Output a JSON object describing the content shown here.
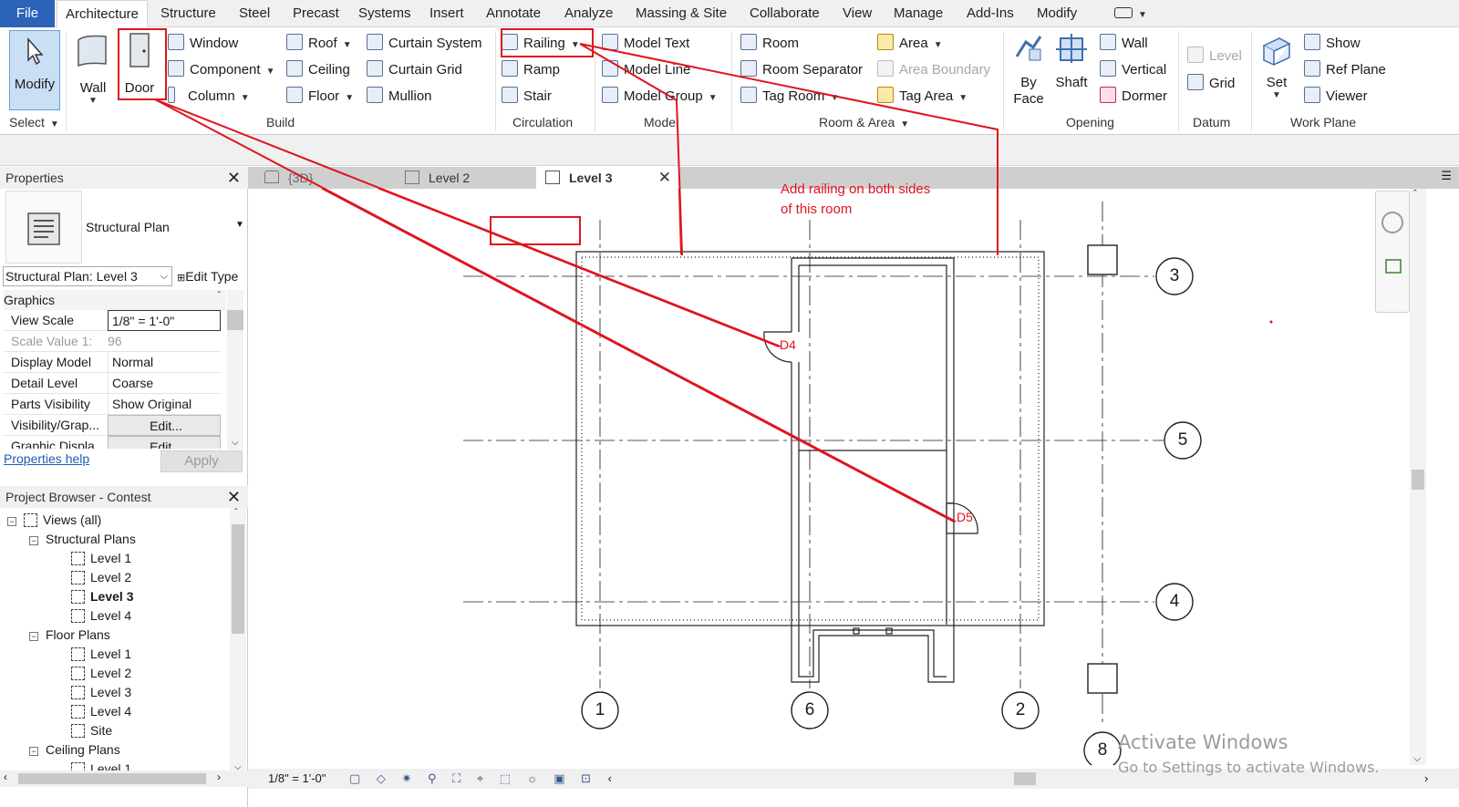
{
  "menubar": {
    "file": "File",
    "tabs": [
      "Architecture",
      "Structure",
      "Steel",
      "Precast",
      "Systems",
      "Insert",
      "Annotate",
      "Analyze",
      "Massing & Site",
      "Collaborate",
      "View",
      "Manage",
      "Add-Ins",
      "Modify"
    ]
  },
  "ribbon": {
    "modify": "Modify",
    "select_label": "Select",
    "wall": "Wall",
    "door": "Door",
    "window": "Window",
    "component": "Component",
    "column": "Column",
    "roof": "Roof",
    "ceiling": "Ceiling",
    "floor": "Floor",
    "curtain_system": "Curtain  System",
    "curtain_grid": "Curtain  Grid",
    "mullion": "Mullion",
    "build_label": "Build",
    "railing": "Railing",
    "ramp": "Ramp",
    "stair": "Stair",
    "circulation_label": "Circulation",
    "model_text": "Model  Text",
    "model_line": "Model  Line",
    "model_group": "Model  Group",
    "model_label": "Model",
    "room": "Room",
    "room_separator": "Room  Separator",
    "tag_room": "Tag  Room",
    "area": "Area",
    "area_boundary": "Area  Boundary",
    "tag_area": "Tag  Area",
    "room_area_label": "Room & Area",
    "by_face_1": "By",
    "by_face_2": "Face",
    "shaft": "Shaft",
    "wall_opening": "Wall",
    "vertical": "Vertical",
    "dormer": "Dormer",
    "opening_label": "Opening",
    "level": "Level",
    "grid": "Grid",
    "datum_label": "Datum",
    "set": "Set",
    "show": "Show",
    "ref_plane": "Ref  Plane",
    "viewer": "Viewer",
    "work_plane_label": "Work Plane"
  },
  "properties": {
    "title": "Properties",
    "type_name": "Structural Plan",
    "instance_select": "Structural Plan: Level 3",
    "edit_type": "Edit Type",
    "group": "Graphics",
    "rows": [
      {
        "k": "View Scale",
        "v": "1/8\" = 1'-0\""
      },
      {
        "k": "Scale Value    1:",
        "v": "96"
      },
      {
        "k": "Display Model",
        "v": "Normal"
      },
      {
        "k": "Detail Level",
        "v": "Coarse"
      },
      {
        "k": "Parts Visibility",
        "v": "Show Original"
      },
      {
        "k": "Visibility/Grap...",
        "v": "Edit..."
      },
      {
        "k": "Graphic Displa...",
        "v": "Edit..."
      }
    ],
    "help": "Properties help",
    "apply": "Apply"
  },
  "browser": {
    "title": "Project Browser - Contest",
    "views_all": "Views (all)",
    "structural_plans": "Structural Plans",
    "structural_items": [
      "Level 1",
      "Level 2",
      "Level 3",
      "Level 4"
    ],
    "floor_plans": "Floor Plans",
    "floor_items": [
      "Level 1",
      "Level 2",
      "Level 3",
      "Level 4",
      "Site"
    ],
    "ceiling_plans": "Ceiling Plans",
    "ceiling_items": [
      "Level 1"
    ]
  },
  "view_tabs": {
    "t1": "{3D}",
    "t2": "Level 2",
    "t3": "Level 3"
  },
  "canvas": {
    "annotation_line1": "Add railing on both sides",
    "annotation_line2": "of this room",
    "door_d4": "D4",
    "door_d5": "D5",
    "grid_3": "3",
    "grid_5": "5",
    "grid_4": "4",
    "grid_1": "1",
    "grid_6": "6",
    "grid_2": "2",
    "grid_8": "8",
    "accent_red": "#e0141e"
  },
  "status": {
    "scale": "1/8\" = 1'-0\""
  },
  "watermark": {
    "line1": "Activate Windows",
    "line2": "Go to Settings to activate Windows."
  }
}
